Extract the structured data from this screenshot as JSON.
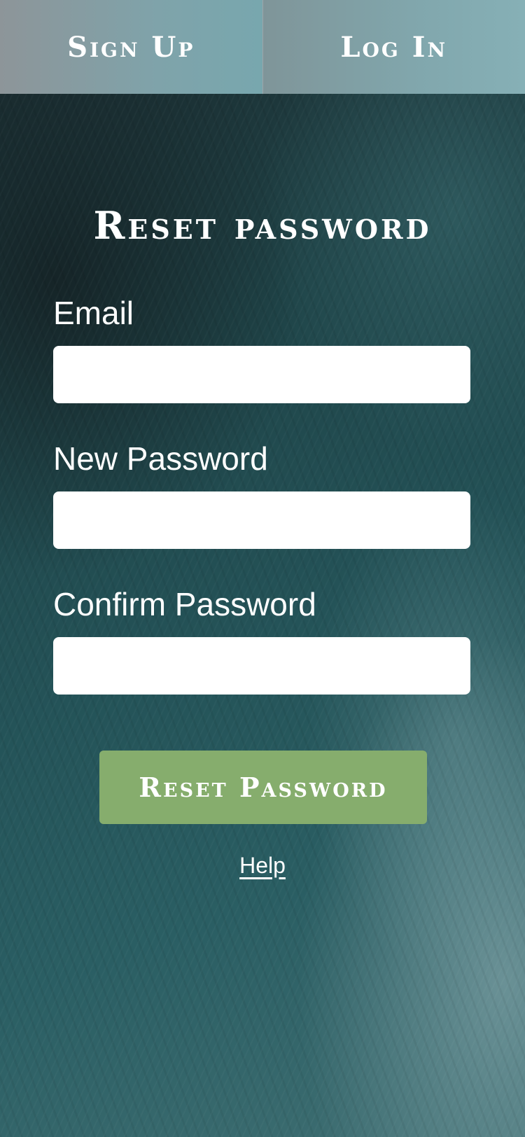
{
  "nav": {
    "sign_up_label": "Sign Up",
    "log_in_label": "Log In"
  },
  "form": {
    "title": "Reset password",
    "email_label": "Email",
    "email_value": "",
    "new_password_label": "New Password",
    "new_password_value": "",
    "confirm_password_label": "Confirm Password",
    "confirm_password_value": "",
    "submit_label": "Reset Password",
    "help_label": "Help"
  },
  "colors": {
    "button_green": "#86ad6d",
    "nav_bar": "#7fa3aa",
    "background_ocean": "#245358"
  }
}
